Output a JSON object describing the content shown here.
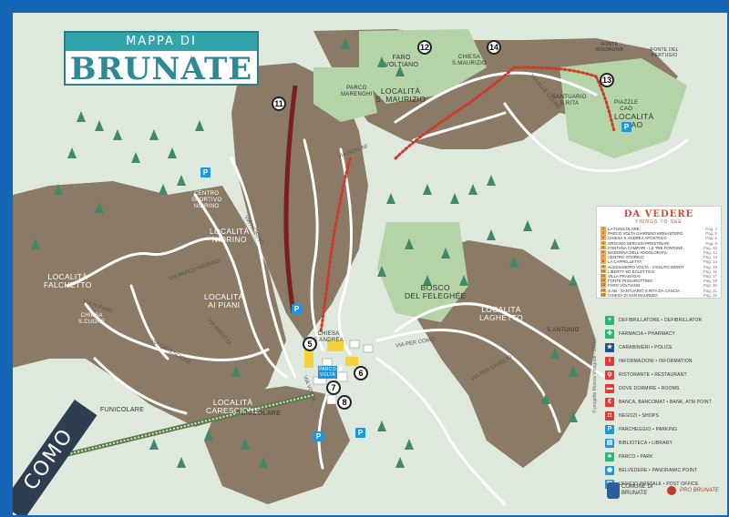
{
  "title": {
    "top": "MAPPA DI",
    "main": "BRUNATE"
  },
  "places": {
    "falchetto": "LOCALITÀ\nFALCHETTO",
    "nidrino": "LOCALITÀ\nNIDRINO",
    "ai_piani": "LOCALITÀ\nAI PIANI",
    "carescione": "LOCALITÀ\nCARESCIONE",
    "s_maurizio": "LOCALITÀ\nS. MAURIZIO",
    "cao": "LOCALITÀ\nCAO",
    "laghetto": "LOCALITÀ\nLAGHETTO",
    "centro_sportivo": "CENTRO\nSPORTIVO\nNIDRINO",
    "bosco": "BOSCO\nDEL FELEGHÉE",
    "parco_marenghi": "PARCO\nMARENGHI",
    "faro_voltiano": "FARO\nVOLTIANO",
    "chiesa_s_maurizio": "CHIESA\nS.MAURIZIO",
    "santuario": "SANTUARIO\nS.RITA",
    "piazzale_cao": "PIAZZLE\nCAO",
    "chiesa_s_cuore": "CHIESA\nS.CUORE",
    "chiesa_s_andrea": "CHIESA\nS.ANDREA",
    "s_antonio": "S.ANTONIO",
    "parco_volta": "PARCO\nVOLTA",
    "funicolare1": "FUNICOLARE",
    "funicolare2": "FUNICOLARE",
    "como": "COMO",
    "fonte_pertugio": "FONTE DEL\nPERTUGIO",
    "fonte_risorgiva": "FONTE\nRISORGIVA"
  },
  "streets": {
    "scalini": "VIA SCALINI",
    "nidrino": "VIA NIDRINO",
    "parco_nidrino": "VIA PARCO NIDRINO",
    "ai_piani": "VIA AI PIANI",
    "pirotta": "VIA PIROTTA",
    "carescione": "VIA CARESCIONE",
    "como": "VIA PER COMO",
    "civiglio": "VIA PER CIVIGLIO",
    "volta": "VIA VOLTA",
    "cao": "VIA ALLE COLME"
  },
  "numbers": [
    "11",
    "12",
    "14",
    "13",
    "5",
    "6",
    "7",
    "8"
  ],
  "legend": {
    "title": "DA VEDERE",
    "subtitle": "THINGS TO SEE",
    "items": [
      {
        "n": "1",
        "t": "LA FUNICOLARE",
        "p": "Pag. 2"
      },
      {
        "n": "2",
        "t": "PARCO VOLTA GIARDINO MONASTERO",
        "p": "Pag. 5"
      },
      {
        "n": "3",
        "t": "CHIESA S.ANDREA APOSTOLO",
        "p": "Pag. 6"
      },
      {
        "n": "4",
        "t": "ORGANO SERASSI-PRESTINARI",
        "p": "Pag. 8"
      },
      {
        "n": "5",
        "t": "FONTANA CAMPARI - LE TRE FONTANE",
        "p": "Pag. 10"
      },
      {
        "n": "6",
        "t": "MADONNA DELL'ADDOLORATA",
        "p": "Pag. 12"
      },
      {
        "n": "7",
        "t": "CENTRO STORICO",
        "p": "Pag. 13"
      },
      {
        "n": "8",
        "t": "LA CAPPELLETTA",
        "p": "Pag. 14"
      },
      {
        "n": "9",
        "t": "ALESSANDRO VOLTA - VISSUTO MONTI",
        "p": "Pag. 15"
      },
      {
        "n": "10",
        "t": "LIBERTY ED ECLETTICO",
        "p": "Pag. 16"
      },
      {
        "n": "11",
        "t": "VILLA PRADAGAI",
        "p": "Pag. 17"
      },
      {
        "n": "12",
        "t": "FONTE PISSAROTTINO",
        "p": "Pag. 19"
      },
      {
        "n": "13",
        "t": "FARO VOLTIANO",
        "p": "Pag. 20"
      },
      {
        "n": "14",
        "t": "S.AB - SANTUARIO S.RITA DA CASCIA",
        "p": "Pag. 21"
      },
      {
        "n": "15",
        "t": "CHIESA DI SAN MAURIZIO",
        "p": "Pag. 23"
      }
    ]
  },
  "services": [
    {
      "label": "DEFIBRILLATORE • DEFIBRILLATOR",
      "color": "#2bb673",
      "glyph": "+"
    },
    {
      "label": "FARMACIA • PHARMACY",
      "color": "#2bb673",
      "glyph": "✚"
    },
    {
      "label": "CARABINIERI • POLICE",
      "color": "#1d4f91",
      "glyph": "★"
    },
    {
      "label": "INFORMAZIONI • INFORMATION",
      "color": "#e53935",
      "glyph": "i"
    },
    {
      "label": "RISTORANTE • RESTAURANT",
      "color": "#e53935",
      "glyph": "ψ"
    },
    {
      "label": "DOVE DORMIRE • ROOMS",
      "color": "#e53935",
      "glyph": "▬"
    },
    {
      "label": "BANCA, BANCOMAT • BANK, ATM POINT",
      "color": "#e53935",
      "glyph": "€"
    },
    {
      "label": "NEGOZI • SHOPS",
      "color": "#e53935",
      "glyph": "◘"
    },
    {
      "label": "PARCHEGGIO • PARKING",
      "color": "#2196d9",
      "glyph": "P"
    },
    {
      "label": "BIBLIOTECA • LIBRARY",
      "color": "#2196d9",
      "glyph": "▤"
    },
    {
      "label": "PARCO • PARK",
      "color": "#2bb673",
      "glyph": "♣"
    },
    {
      "label": "BELVEDERE • PANORAMIC POINT",
      "color": "#2196d9",
      "glyph": "◉"
    },
    {
      "label": "UFFICIO POSTALE • POST OFFICE",
      "color": "#2196d9",
      "glyph": "✉"
    }
  ],
  "logos": {
    "comune": "COMUNE DI\nBRUNATE",
    "pro": "PRO BRUNATE"
  },
  "copyright": "© progetto Monica Vinogradi - 2017",
  "colors": {
    "frame": "#1565b6",
    "land": "#dfe8dc",
    "hill": "#8a7a66",
    "green": "#c2dcb7",
    "road": "#ffffff",
    "trail_red": "#d03a2a",
    "accent": "#33a4ac"
  }
}
